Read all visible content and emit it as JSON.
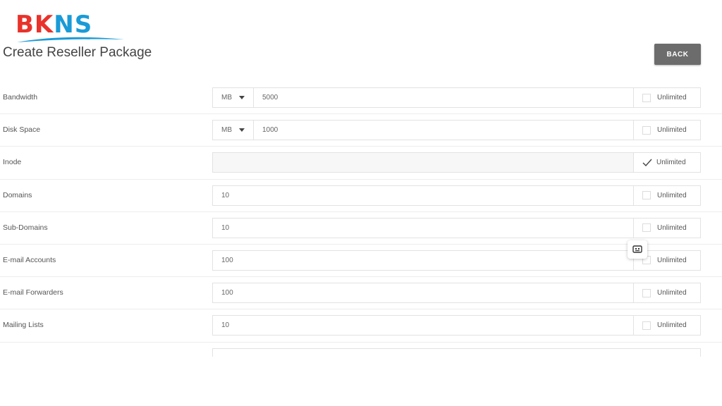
{
  "brand": {
    "logo_left": "BK",
    "logo_right": "NS"
  },
  "page": {
    "title": "Create Reseller Package",
    "back_label": "BACK"
  },
  "rows": [
    {
      "label": "Bandwidth",
      "unit": "MB",
      "value": "5000",
      "unlimited_label": "Unlimited",
      "unlimited": false
    },
    {
      "label": "Disk Space",
      "unit": "MB",
      "value": "1000",
      "unlimited_label": "Unlimited",
      "unlimited": false
    },
    {
      "label": "Inode",
      "value": "",
      "unlimited_label": "Unlimited",
      "unlimited": true
    },
    {
      "label": "Domains",
      "value": "10",
      "unlimited_label": "Unlimited",
      "unlimited": false
    },
    {
      "label": "Sub-Domains",
      "value": "10",
      "unlimited_label": "Unlimited",
      "unlimited": false
    },
    {
      "label": "E-mail Accounts",
      "value": "100",
      "unlimited_label": "Unlimited",
      "unlimited": false
    },
    {
      "label": "E-mail Forwarders",
      "value": "100",
      "unlimited_label": "Unlimited",
      "unlimited": false
    },
    {
      "label": "Mailing Lists",
      "value": "10",
      "unlimited_label": "Unlimited",
      "unlimited": false
    }
  ],
  "colors": {
    "logo_red": "#e8322b",
    "logo_blue": "#1a9bd7",
    "back_button": "#6c6c6c"
  },
  "icons": {
    "unit_dropdown": "caret-down-icon",
    "checked": "checkmark-icon",
    "floating": "extension-icon"
  }
}
